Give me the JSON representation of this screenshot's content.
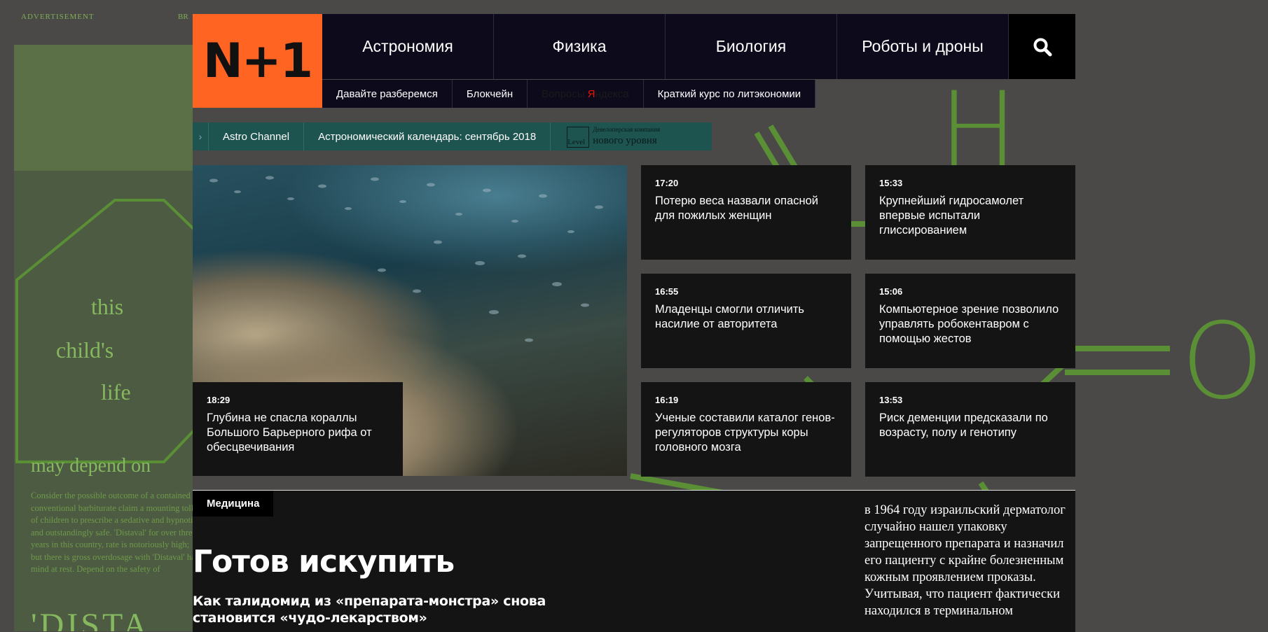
{
  "background_ad": {
    "label_left": "Advertisement",
    "label_right": "BR",
    "line1": "this",
    "line2": "child's",
    "line3": "life",
    "line4": "may depend on",
    "line5": "'DISTA",
    "fine_print": "Consider the possible outcome of a contained a conventional barbiturate claim a mounting toll of children to prescribe a sedative and hypnotic and outstandingly safe. 'Distaval' for over three years in this country, rate is notoriously high; but there is gross overdosage with 'Distaval' has mind at rest. Depend on the safety of",
    "chem_h": "H",
    "chem_o": "O",
    "accent_color": "#5a8f36"
  },
  "header": {
    "logo_text": "N+1",
    "logo_color": "#ff6422",
    "nav": [
      "Астрономия",
      "Физика",
      "Биология",
      "Роботы и дроны"
    ],
    "subnav": [
      "Давайте разберемся",
      "Блокчейн",
      "Краткий курс по литэкономии"
    ],
    "yandex_pre": "Вопросы",
    "yandex_brand": "Я",
    "yandex_post": "ндекса"
  },
  "channel_bar": {
    "items": [
      "Astro Channel",
      "Астрономический календарь: сентябрь 2018"
    ],
    "promo_small": "Девелоперская компания",
    "promo_big": "нового уровня",
    "promo_logo": "Level",
    "color": "#1d5450"
  },
  "featured": {
    "time": "18:29",
    "headline": "Глубина не спасла кораллы Большого Барьерного рифа от обесцвечивания"
  },
  "news": [
    {
      "time": "17:20",
      "headline": "Потерю веса назвали опасной для пожилых женщин"
    },
    {
      "time": "15:33",
      "headline": "Крупнейший гидросамолет впервые испытали глиссированием"
    },
    {
      "time": "16:55",
      "headline": "Младенцы смогли отличить насилие от авторитета"
    },
    {
      "time": "15:06",
      "headline": "Компьютерное зрение позволило управлять робокентавром с помощью жестов"
    },
    {
      "time": "16:19",
      "headline": "Ученые составили каталог генов-регуляторов структуры коры головного мозга"
    },
    {
      "time": "13:53",
      "headline": "Риск деменции предсказали по возрасту, полу и генотипу"
    }
  ],
  "article": {
    "rubric": "Медицина",
    "title": "Готов искупить",
    "subtitle": "Как талидомид из «препарата-монстра» снова становится «чудо-лекарством»",
    "body": "в 1964 году израильский дерматолог случайно нашел упаковку запрещенного препарата и назначил его пациенту с крайне болезненным кожным проявлением проказы. Учитывая, что пациент фактически находился в терминальном"
  }
}
